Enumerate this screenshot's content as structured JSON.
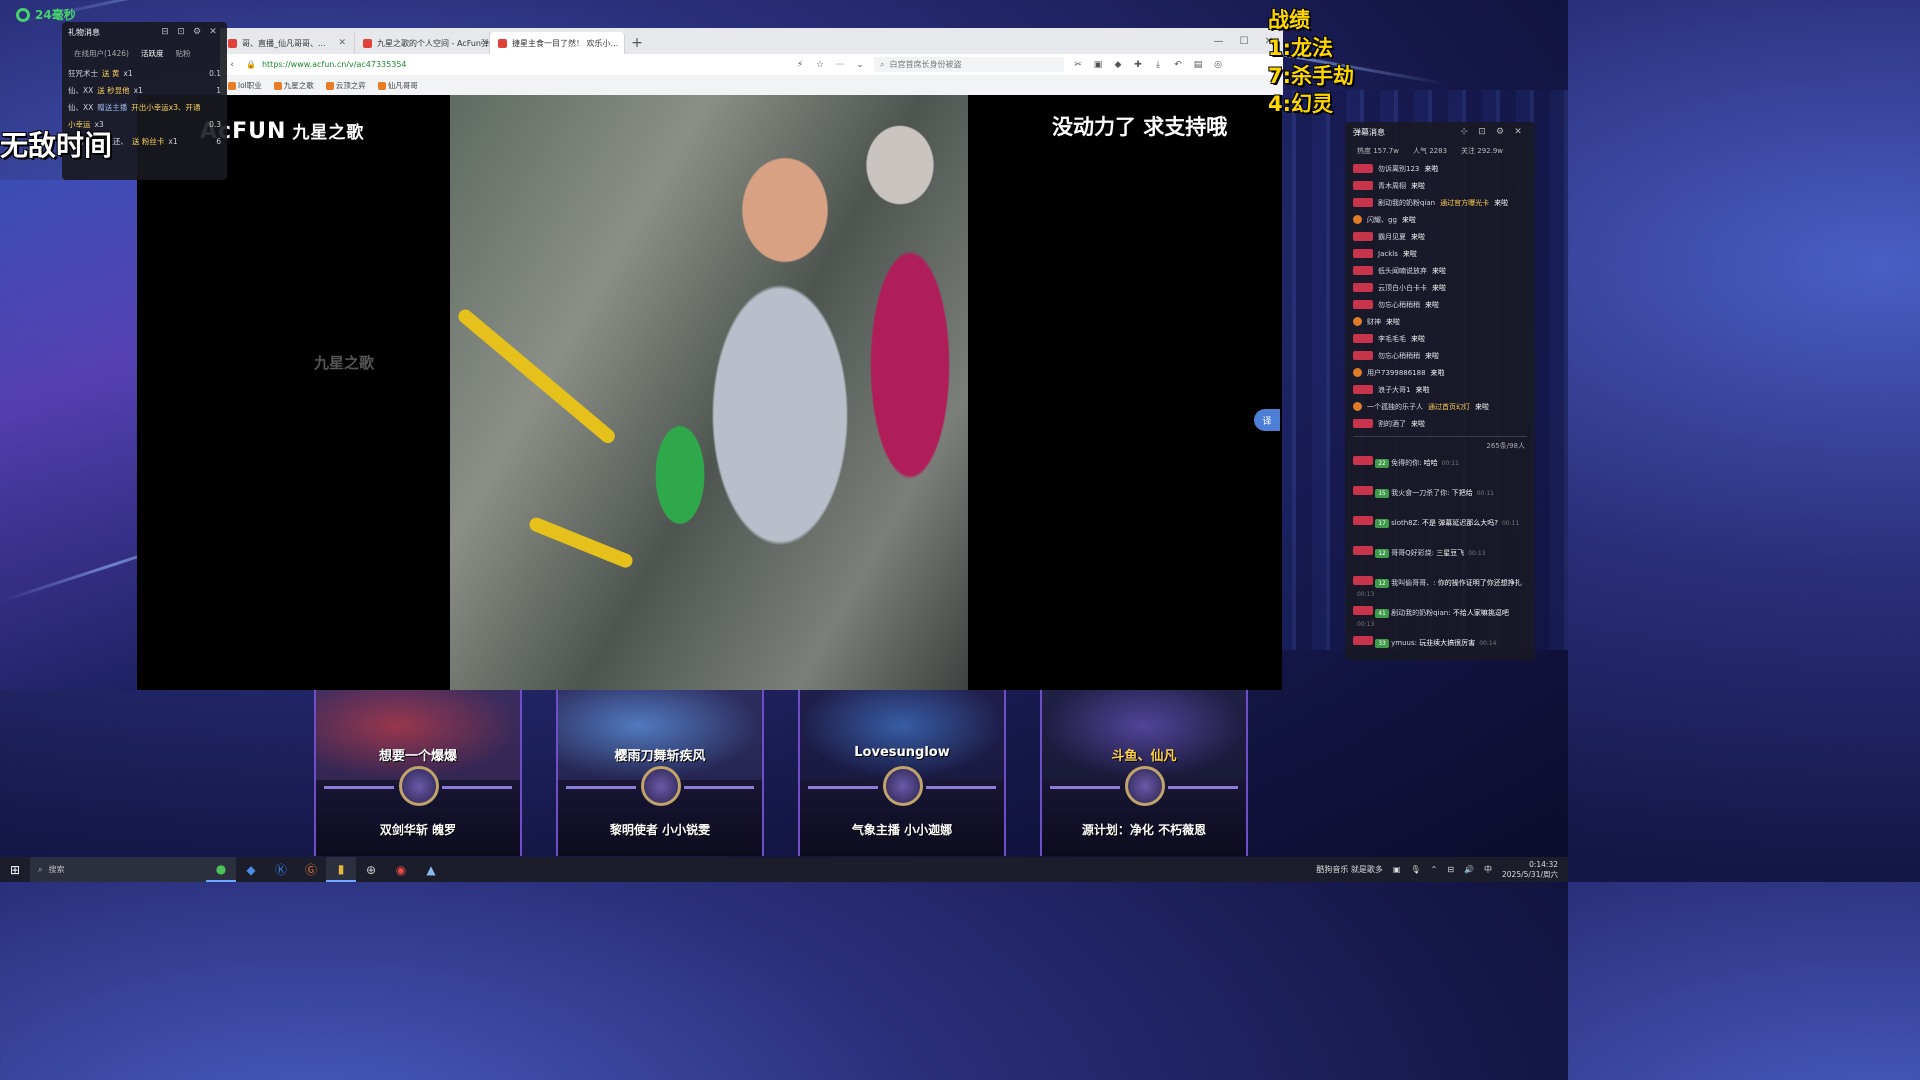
{
  "ping": "24毫秒",
  "overlay_left": "无敌时间",
  "stats": {
    "title": "战绩",
    "lines": [
      "1:龙法",
      "7:杀手劫",
      "4:幻灵"
    ]
  },
  "gift_panel": {
    "title": "礼物消息",
    "tabs": [
      "在线用户(1426)",
      "活跃度",
      "贴粉"
    ],
    "rows": [
      {
        "user": "狂咒术士",
        "verb": "送 黄",
        "count": "x1",
        "val": "0.1"
      },
      {
        "user": "仙、XX",
        "verb": "送 秒显他",
        "count": "x1",
        "val": "1"
      },
      {
        "user": "仙、XX",
        "verb": "赠送主播",
        "extra": "开出小幸运x3、开通",
        "count": "",
        "val": ""
      },
      {
        "user": "",
        "verb": "小幸运",
        "count": "x3",
        "val": "0.3"
      },
      {
        "user": "时光一去不复还、",
        "verb": "送 粉丝卡",
        "count": "x1",
        "val": "6"
      }
    ]
  },
  "browser": {
    "tabs": [
      {
        "title": "哥、直播_仙凡哥哥、...",
        "active": false
      },
      {
        "title": "九星之歌的个人空间 - AcFun弹...",
        "active": false
      },
      {
        "title": "捷星主食一目了然！ 欢乐小...",
        "active": true
      }
    ],
    "url": "https://www.acfun.cn/v/ac47335354",
    "search_placeholder": "白宫首席长身份被盗",
    "bookmarks": [
      "lol职业",
      "九星之歌",
      "云顶之弈",
      "仙凡哥哥"
    ]
  },
  "video": {
    "logo": "AcFUN",
    "logo_sub": "九星之歌",
    "watermark": "九星之歌",
    "caption": "没动力了 求支持哦",
    "side_badge": "译"
  },
  "chat": {
    "title": "弹幕消息",
    "stats": [
      "热度 157.7w",
      "人气 2283",
      "关注 292.9w"
    ],
    "entries": [
      {
        "user": "勿诉离别123",
        "action": "来啦"
      },
      {
        "user": "青木周栩",
        "action": "来啦"
      },
      {
        "user": "剧动我的奶粉qian",
        "via": "通过官方曝光卡",
        "action": "来啦"
      },
      {
        "user": "闪耀、gg",
        "action": "来啦",
        "ok": true
      },
      {
        "user": "霸月见夏",
        "action": "来啦"
      },
      {
        "user": "Jackls",
        "action": "来啦"
      },
      {
        "user": "低头闻喃说放弃",
        "action": "来啦"
      },
      {
        "user": "云顶白小白卡卡",
        "action": "来啦"
      },
      {
        "user": "勿忘心稍稍稍",
        "action": "来啦"
      },
      {
        "user": "财神",
        "action": "来啦",
        "ok": true
      },
      {
        "user": "李毛毛毛",
        "action": "来啦"
      },
      {
        "user": "勿忘心稍稍稍",
        "action": "来啦"
      },
      {
        "user": "用户7399886188",
        "action": "来啦",
        "ok": true
      },
      {
        "user": "浪子大哥1",
        "action": "来啦"
      },
      {
        "user": "一个孤独的乐子人",
        "via": "通过首页幻灯",
        "action": "来啦",
        "ok": true
      },
      {
        "user": "割的酒了",
        "action": "来啦"
      }
    ],
    "count": "265条/98人",
    "messages": [
      {
        "fan": "22",
        "user": "免得的你",
        "text": "哈哈",
        "time": "00:11"
      },
      {
        "fan": "15",
        "user": "我火食一刀杀了你",
        "text": "下把给",
        "time": "00:11"
      },
      {
        "fan": "17",
        "user": "sloth8Z",
        "text": "不是 弹幕延迟那么大吗?",
        "time": "00:11"
      },
      {
        "fan": "12",
        "user": "哥哥Q好彩烧",
        "text": "三星豆飞",
        "time": "00:13"
      },
      {
        "fan": "12",
        "user": "我叫偷哥哥、",
        "text": "你的操作证明了你还想挣扎",
        "time": "00:13"
      },
      {
        "fan": "41",
        "user": "剧动我的奶粉qian",
        "text": "不给人家嘛挑逗吧",
        "time": "00:13"
      },
      {
        "fan": "33",
        "user": "ymuus",
        "text": "玩韭续大搞很厉害",
        "time": "00:14"
      }
    ]
  },
  "cards": [
    {
      "name": "想要一个爆爆",
      "hero": "双剑华斩 魄罗",
      "gold": false
    },
    {
      "name": "樱雨刀舞斩疾风",
      "hero": "黎明使者 小小锐雯",
      "gold": false
    },
    {
      "name": "Lovesunglow",
      "hero": "气象主播 小小迦娜",
      "gold": false
    },
    {
      "name": "斗鱼、仙凡",
      "hero": "源计划：净化 不朽薇恩",
      "gold": true
    }
  ],
  "taskbar": {
    "search": "搜索",
    "tray_text": "酷狗音乐 就是歌多",
    "time": "0:14:32",
    "date": "2025/5/31/周六"
  }
}
